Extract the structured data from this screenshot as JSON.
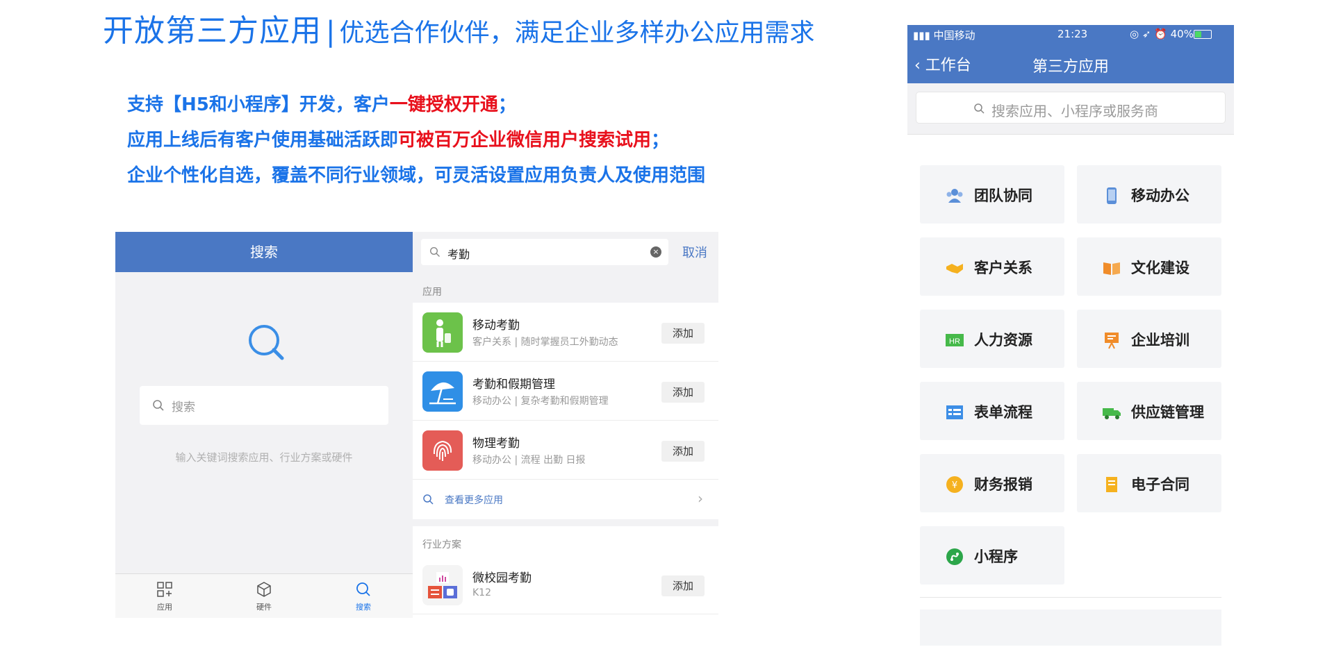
{
  "title": {
    "main": "开放第三方应用",
    "separator": "|",
    "sub": "优选合作伙伴，满足企业多样办公应用需求"
  },
  "bullets": [
    {
      "blue": "支持【H5和小程序】开发，客户",
      "red": "一键授权开通",
      "tail": "；"
    },
    {
      "blue": "应用上线后有客户使用基础活跃即",
      "red": "可被百万企业微信用户搜索试用",
      "tail": "；"
    },
    {
      "blue": "企业个性化自选，覆盖不同行业领域，可灵活设置应用负责人及使用范围",
      "red": "",
      "tail": ""
    }
  ],
  "search_screen": {
    "header_title": "搜索",
    "search_placeholder": "搜索",
    "hint": "输入关键词搜索应用、行业方案或硬件",
    "tabs": [
      {
        "label": "应用",
        "icon": "apps-grid-icon"
      },
      {
        "label": "硬件",
        "icon": "hardware-box-icon"
      },
      {
        "label": "搜索",
        "icon": "search-icon"
      }
    ]
  },
  "results_screen": {
    "query": "考勤",
    "cancel_label": "取消",
    "apps_section_label": "应用",
    "results": [
      {
        "name": "移动考勤",
        "desc": "客户关系 | 随时掌握员工外勤动态",
        "add_label": "添加",
        "icon": "field-attendance-icon",
        "color": "#6cc24a"
      },
      {
        "name": "考勤和假期管理",
        "desc": "移动办公 | 复杂考勤和假期管理",
        "add_label": "添加",
        "icon": "beach-umbrella-icon",
        "color": "#2f8fe6"
      },
      {
        "name": "物理考勤",
        "desc": "移动办公 | 流程 出勤 日报",
        "add_label": "添加",
        "icon": "fingerprint-icon",
        "color": "#e45c57"
      }
    ],
    "more_label": "查看更多应用",
    "solutions_section_label": "行业方案",
    "solution": {
      "name": "微校园考勤",
      "desc": "K12",
      "add_label": "添加",
      "icon": "campus-attendance-icon"
    }
  },
  "third_party_screen": {
    "status_bar": {
      "carrier": "中国移动",
      "time": "21:23",
      "battery": "40%",
      "battery_fraction": 0.4
    },
    "back_label": "工作台",
    "nav_title": "第三方应用",
    "search_placeholder": "搜索应用、小程序或服务商",
    "categories": [
      {
        "label": "团队协同",
        "icon": "team-icon",
        "color": "#5b8fd8"
      },
      {
        "label": "移动办公",
        "icon": "mobile-phone-icon",
        "color": "#5b8fd8"
      },
      {
        "label": "客户关系",
        "icon": "handshake-icon",
        "color": "#f5b11f"
      },
      {
        "label": "文化建设",
        "icon": "open-book-icon",
        "color": "#f08c2a"
      },
      {
        "label": "人力资源",
        "icon": "hr-badge-icon",
        "color": "#46b94a"
      },
      {
        "label": "企业培训",
        "icon": "presentation-board-icon",
        "color": "#f08c2a"
      },
      {
        "label": "表单流程",
        "icon": "form-table-icon",
        "color": "#3d8ee6"
      },
      {
        "label": "供应链管理",
        "icon": "truck-icon",
        "color": "#46b94a"
      },
      {
        "label": "财务报销",
        "icon": "yen-coin-icon",
        "color": "#f5b11f"
      },
      {
        "label": "电子合同",
        "icon": "contract-document-icon",
        "color": "#f5b11f"
      },
      {
        "label": "小程序",
        "icon": "mini-program-icon",
        "color": "#2ca64a"
      }
    ]
  }
}
